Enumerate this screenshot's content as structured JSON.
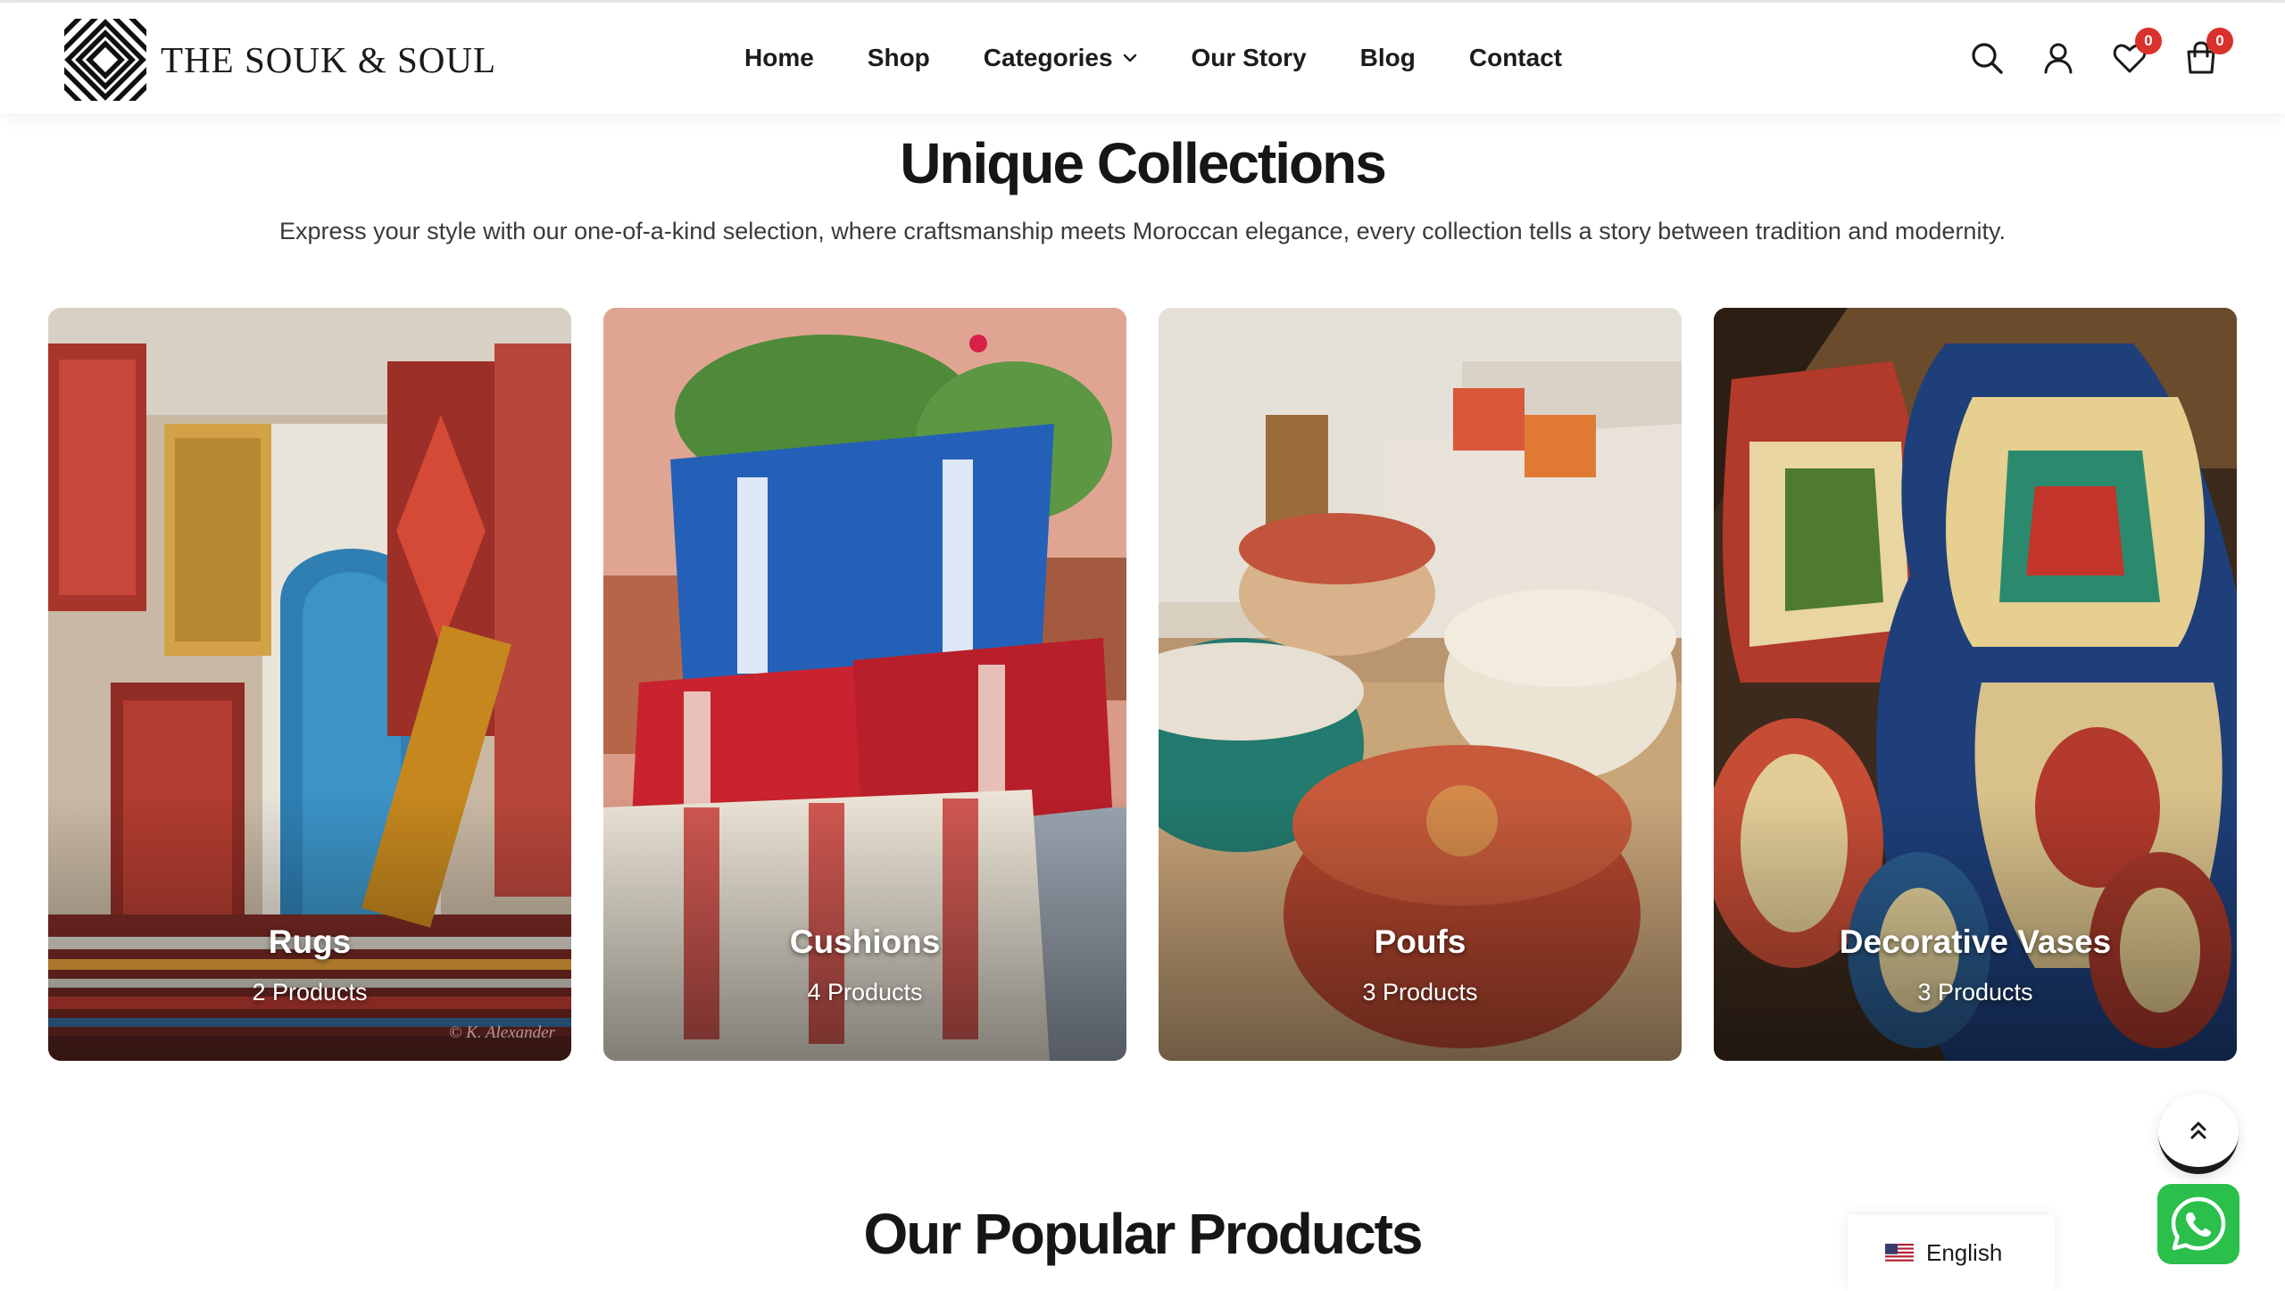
{
  "brand": {
    "name": "THE SOUK & SOUL"
  },
  "nav": {
    "items": [
      {
        "label": "Home"
      },
      {
        "label": "Shop"
      },
      {
        "label": "Categories",
        "has_dropdown": true
      },
      {
        "label": "Our Story"
      },
      {
        "label": "Blog"
      },
      {
        "label": "Contact"
      }
    ]
  },
  "header_icons": {
    "search": "search-icon",
    "account": "user-icon",
    "wishlist": {
      "icon": "heart-icon",
      "count": "0"
    },
    "cart": {
      "icon": "bag-icon",
      "count": "0"
    }
  },
  "collections": {
    "title": "Unique Collections",
    "subtitle": "Express your style with our one-of-a-kind selection, where craftsmanship meets Moroccan elegance, every collection tells a story between tradition and modernity.",
    "cards": [
      {
        "title": "Rugs",
        "count": "2 Products",
        "credit": "© K. Alexander"
      },
      {
        "title": "Cushions",
        "count": "4 Products"
      },
      {
        "title": "Poufs",
        "count": "3 Products"
      },
      {
        "title": "Decorative Vases",
        "count": "3 Products"
      }
    ]
  },
  "popular": {
    "title": "Our Popular Products"
  },
  "language": {
    "label": "English",
    "flag": "us-flag-icon"
  },
  "widgets": {
    "scroll_top": "double-chevron-up-icon",
    "chat": "whatsapp-icon"
  },
  "colors": {
    "badge": "#d9312b",
    "whatsapp": "#2bbf4b",
    "text": "#1a1a1a"
  }
}
